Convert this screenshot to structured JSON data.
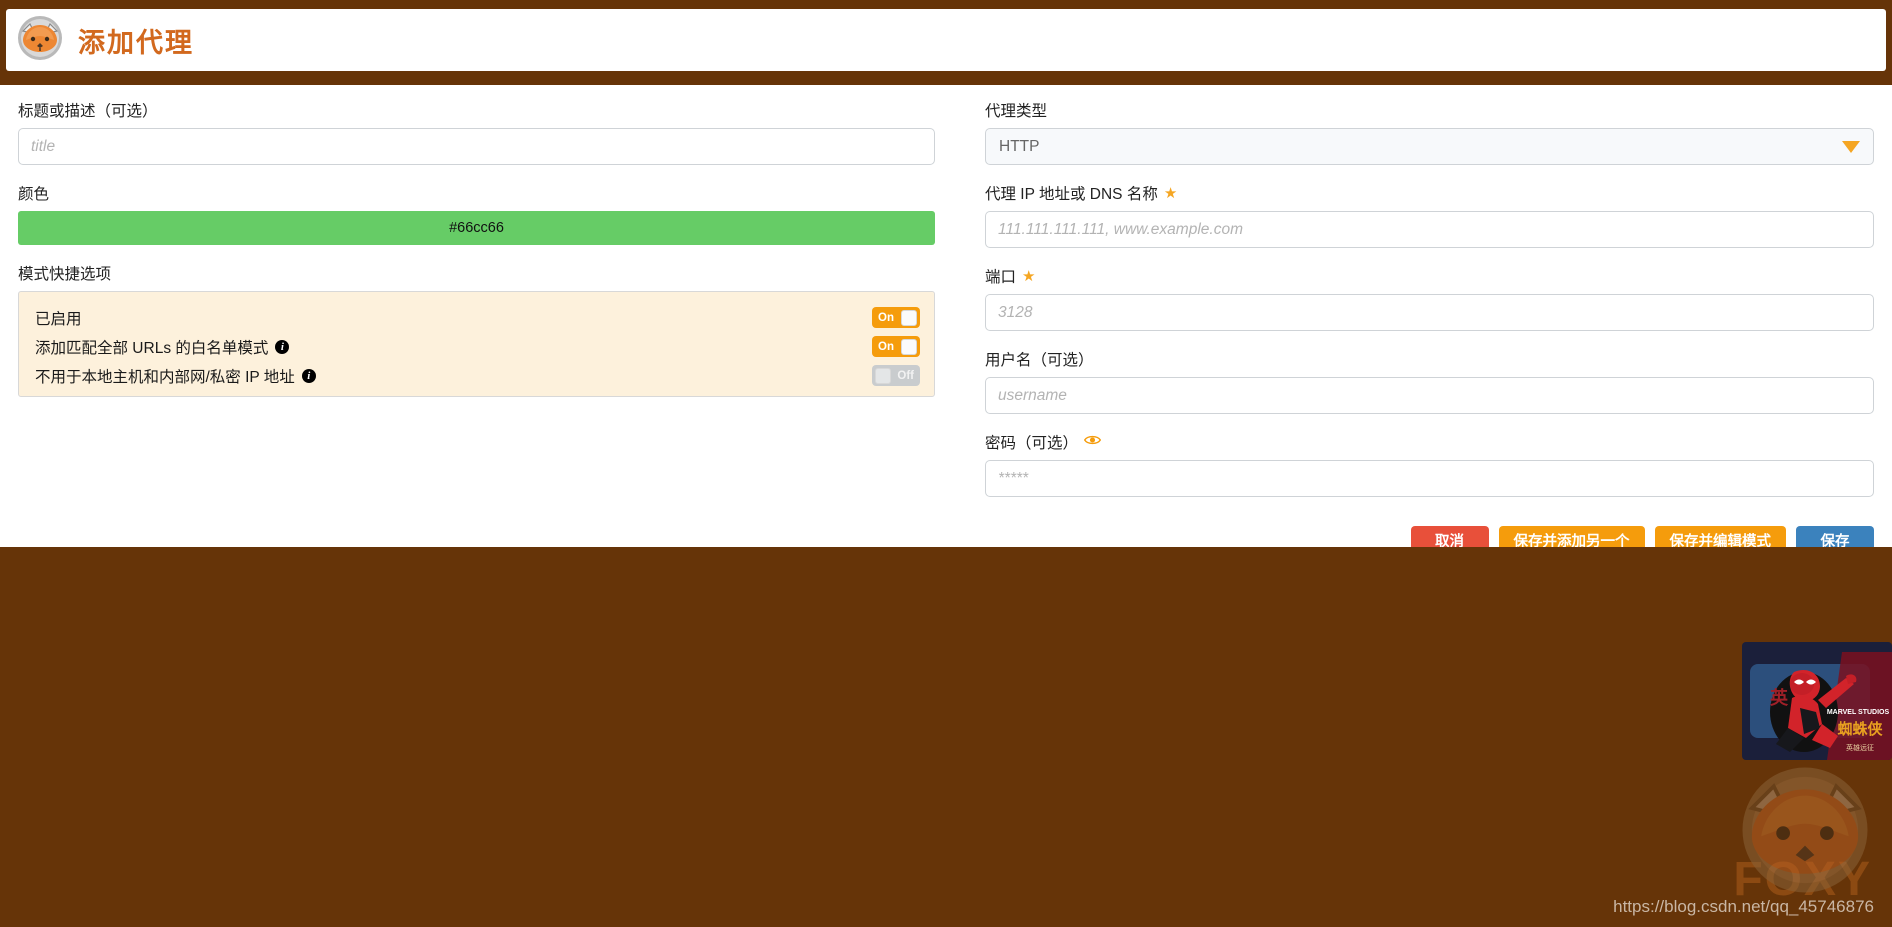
{
  "header": {
    "title": "添加代理",
    "logo_icon": "fox-logo-icon"
  },
  "left": {
    "title_field": {
      "label": "标题或描述（可选）",
      "placeholder": "title",
      "value": ""
    },
    "color_field": {
      "label": "颜色",
      "value": "#66cc66",
      "swatch_color": "#66cc66"
    },
    "shortcuts": {
      "label": "模式快捷选项",
      "options": [
        {
          "text": "已启用",
          "has_info": false,
          "state": "On"
        },
        {
          "text": "添加匹配全部 URLs 的白名单模式",
          "has_info": true,
          "state": "On"
        },
        {
          "text": "不用于本地主机和内部网/私密 IP 地址",
          "has_info": true,
          "state": "Off"
        }
      ]
    }
  },
  "right": {
    "proxy_type": {
      "label": "代理类型",
      "value": "HTTP",
      "caret_icon": "chevron-down-icon"
    },
    "host": {
      "label": "代理 IP 地址或 DNS 名称",
      "required_icon": "star-icon",
      "placeholder": "111.111.111.111, www.example.com",
      "value": ""
    },
    "port": {
      "label": "端口",
      "required_icon": "star-icon",
      "placeholder": "3128",
      "value": ""
    },
    "username": {
      "label": "用户名（可选）",
      "placeholder": "username",
      "value": ""
    },
    "password": {
      "label": "密码（可选）",
      "reveal_icon": "eye-icon",
      "placeholder": "*****",
      "value": ""
    }
  },
  "buttons": {
    "cancel": "取消",
    "save_add_another": "保存并添加另一个",
    "save_edit_patterns": "保存并编辑模式",
    "save": "保存"
  },
  "watermark": {
    "url": "https://blog.csdn.net/qq_45746876",
    "brand_text": "FOXY",
    "poster_icon": "spiderman-poster-image",
    "fox_icon": "fox-watermark-icon"
  },
  "colors": {
    "brown_bg": "#663408",
    "accent_orange": "#f59c0c",
    "title_orange": "#d2691e",
    "cancel_red": "#e8503a",
    "save_blue": "#3b82bd",
    "shortcut_bg": "#fdf1dc"
  }
}
